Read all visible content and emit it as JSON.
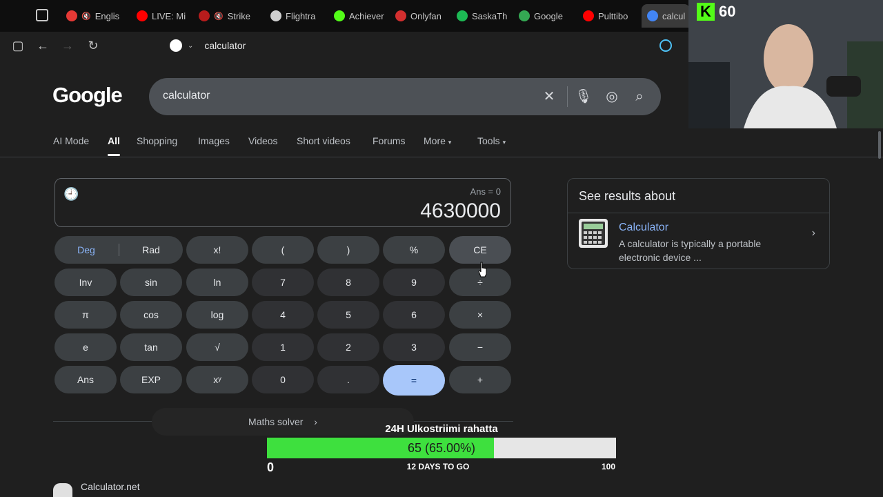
{
  "tabs": [
    {
      "label": "Englis",
      "color": "#e53935",
      "muted": true
    },
    {
      "label": "LIVE: Mi",
      "color": "#ff0000",
      "muted": false
    },
    {
      "label": "Strike",
      "color": "#b71c1c",
      "muted": true
    },
    {
      "label": "Flightra",
      "color": "#cfcfcf",
      "muted": false
    },
    {
      "label": "Achiever",
      "color": "#53fc18",
      "muted": false
    },
    {
      "label": "Onlyfan",
      "color": "#d32f2f",
      "muted": false
    },
    {
      "label": "SaskaTh",
      "color": "#1db954",
      "muted": false
    },
    {
      "label": "Google",
      "color": "#34a853",
      "muted": false
    },
    {
      "label": "Pulttibo",
      "color": "#ff0000",
      "muted": false
    },
    {
      "label": "calcul",
      "color": "#4285f4",
      "muted": false,
      "active": true
    }
  ],
  "omnibox": {
    "text": "calculator"
  },
  "google": {
    "logo": "Google",
    "query": "calculator"
  },
  "nav": {
    "ai_mode": "AI Mode",
    "all": "All",
    "shopping": "Shopping",
    "images": "Images",
    "videos": "Videos",
    "short_videos": "Short videos",
    "forums": "Forums",
    "more": "More",
    "tools": "Tools"
  },
  "calculator": {
    "ans": "Ans = 0",
    "result": "4630000",
    "deg": "Deg",
    "rad": "Rad",
    "keys": {
      "fact": "x!",
      "lparen": "(",
      "rparen": ")",
      "percent": "%",
      "ce": "CE",
      "inv": "Inv",
      "sin": "sin",
      "ln": "ln",
      "k7": "7",
      "k8": "8",
      "k9": "9",
      "div": "÷",
      "pi": "π",
      "cos": "cos",
      "log": "log",
      "k4": "4",
      "k5": "5",
      "k6": "6",
      "mul": "×",
      "e": "e",
      "tan": "tan",
      "sqrt": "√",
      "k1": "1",
      "k2": "2",
      "k3": "3",
      "sub": "−",
      "ansk": "Ans",
      "exp": "EXP",
      "pow": "xʸ",
      "k0": "0",
      "dot": ".",
      "eq": "=",
      "add": "+"
    },
    "maths_solver": "Maths solver"
  },
  "knowledge_panel": {
    "header": "See results about",
    "title": "Calculator",
    "description": "A calculator is typically a portable electronic device ..."
  },
  "result": {
    "site": "Calculator.net"
  },
  "overlay": {
    "kick_count": "60",
    "goal_title": "24H Ulkostriimi rahatta",
    "goal_progress": 0.65,
    "goal_text": "65 (65.00%)",
    "goal_min": "0",
    "goal_days": "12 DAYS TO GO",
    "goal_max": "100"
  }
}
